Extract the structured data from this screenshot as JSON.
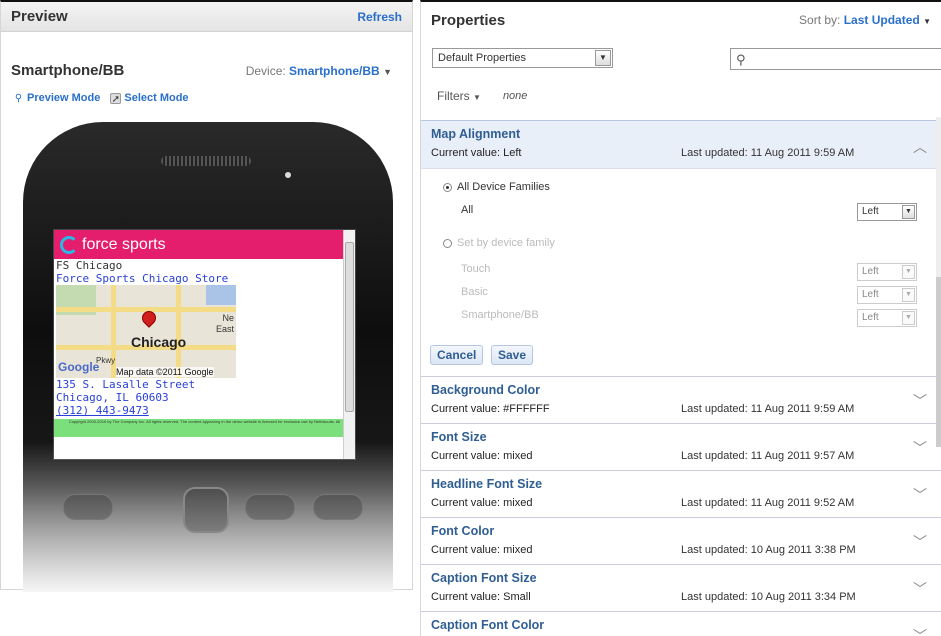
{
  "preview": {
    "title": "Preview",
    "refresh": "Refresh",
    "device_name": "Smartphone/BB",
    "device_label": "Device:",
    "device_value": "Smartphone/BB",
    "preview_mode": "Preview Mode",
    "select_mode": "Select Mode",
    "screen": {
      "brand": "force sports",
      "store_short": "FS Chicago",
      "store_link": "Force Sports Chicago Store",
      "map_city": "Chicago",
      "map_ne": "Ne",
      "map_east": "East",
      "map_pkwy": "Pkwy",
      "map_credit": "Map data ©2011 Google",
      "map_google": "Google",
      "address1": "135 S. Lasalle Street",
      "address2": "Chicago, IL 60603",
      "phone": "(312) 443-9473",
      "footer": "Copyright 2000-2010 by The Company Inc. All rights reserved. The content appearing in the demo website is licensed for exclusive use by Netbiscuits. All"
    }
  },
  "properties": {
    "title": "Properties",
    "sort_label": "Sort by:",
    "sort_value": "Last Updated",
    "select_value": "Default Properties",
    "filters_label": "Filters",
    "filters_value": "none",
    "expanded": {
      "title": "Map Alignment",
      "current": "Current value: Left",
      "updated": "Last updated: 11 Aug 2011 9:59 AM",
      "all_families": "All Device Families",
      "all_label": "All",
      "all_value": "Left",
      "by_family": "Set by device family",
      "touch": "Touch",
      "touch_value": "Left",
      "basic": "Basic",
      "basic_value": "Left",
      "smartphone": "Smartphone/BB",
      "smartphone_value": "Left",
      "cancel": "Cancel",
      "save": "Save"
    },
    "rows": [
      {
        "title": "Background Color",
        "current": "Current value: #FFFFFF",
        "updated": "Last updated: 11 Aug 2011 9:59 AM"
      },
      {
        "title": "Font Size",
        "current": "Current value: mixed",
        "updated": "Last updated: 11 Aug 2011 9:57 AM"
      },
      {
        "title": "Headline Font Size",
        "current": "Current value: mixed",
        "updated": "Last updated: 11 Aug 2011 9:52 AM"
      },
      {
        "title": "Font Color",
        "current": "Current value: mixed",
        "updated": "Last updated: 10 Aug 2011 3:38 PM"
      },
      {
        "title": "Caption Font Size",
        "current": "Current value: Small",
        "updated": "Last updated: 10 Aug 2011 3:34 PM"
      },
      {
        "title": "Caption Font Color",
        "current": "",
        "updated": ""
      }
    ]
  },
  "colors": {
    "accent": "#2a6fc9",
    "brand_pink": "#e51d6d",
    "row_title": "#2f5e93"
  }
}
